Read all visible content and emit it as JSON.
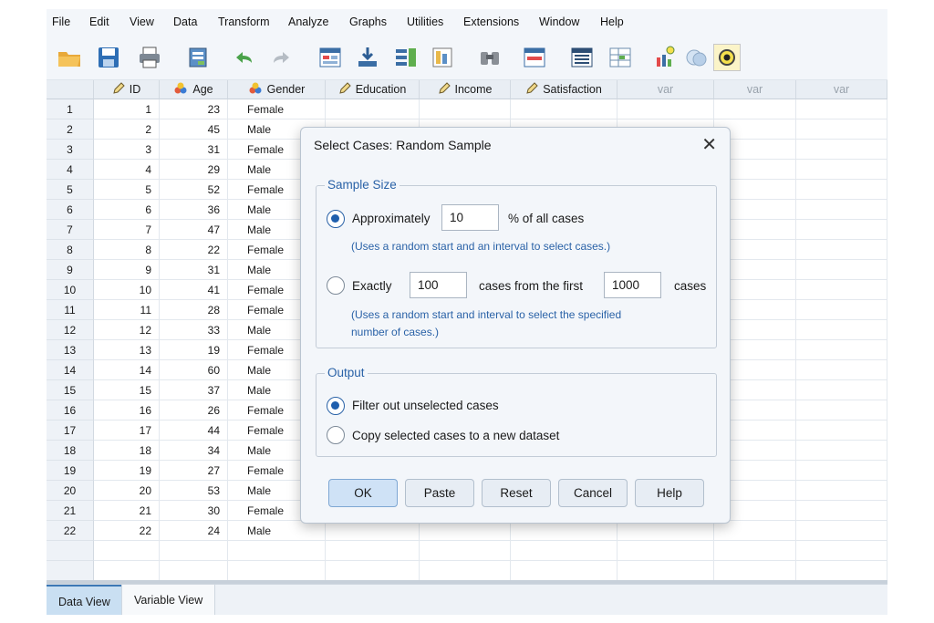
{
  "menu": {
    "file": "File",
    "edit": "Edit",
    "view": "View",
    "data": "Data",
    "transform": "Transform",
    "analyze": "Analyze",
    "graphs": "Graphs",
    "utilities": "Utilities",
    "extensions": "Extensions",
    "window": "Window",
    "help": "Help"
  },
  "toolbar": {
    "icons": [
      "open-folder-icon",
      "save-icon",
      "print-icon",
      "dialog-recall-icon",
      "undo-icon",
      "redo-icon",
      "goto-case-icon",
      "goto-variable-icon",
      "variables-icon",
      "run-descriptives-icon",
      "find-icon",
      "insert-cases-icon",
      "insert-variable-icon",
      "split-file-icon",
      "value-labels-icon",
      "use-sets-icon",
      "show-all-icon"
    ]
  },
  "grid": {
    "columns": [
      {
        "name": "ID",
        "icon": "pencil-icon"
      },
      {
        "name": "Age",
        "icon": "scale-icon"
      },
      {
        "name": "Gender",
        "icon": "nominal-icon"
      },
      {
        "name": "Education",
        "icon": "pencil-icon"
      },
      {
        "name": "Income",
        "icon": "pencil-icon"
      },
      {
        "name": "Satisfaction",
        "icon": "pencil-icon"
      },
      {
        "name": "var"
      },
      {
        "name": "var"
      },
      {
        "name": "var"
      }
    ],
    "rows": [
      {
        "n": "1",
        "id": "1",
        "age": "23",
        "gender": "Female"
      },
      {
        "n": "2",
        "id": "2",
        "age": "45",
        "gender": "Male"
      },
      {
        "n": "3",
        "id": "3",
        "age": "31",
        "gender": "Female"
      },
      {
        "n": "4",
        "id": "4",
        "age": "29",
        "gender": "Male"
      },
      {
        "n": "5",
        "id": "5",
        "age": "52",
        "gender": "Female"
      },
      {
        "n": "6",
        "id": "6",
        "age": "36",
        "gender": "Male"
      },
      {
        "n": "7",
        "id": "7",
        "age": "47",
        "gender": "Male"
      },
      {
        "n": "8",
        "id": "8",
        "age": "22",
        "gender": "Female"
      },
      {
        "n": "9",
        "id": "9",
        "age": "31",
        "gender": "Male"
      },
      {
        "n": "10",
        "id": "10",
        "age": "41",
        "gender": "Female"
      },
      {
        "n": "11",
        "id": "11",
        "age": "28",
        "gender": "Female"
      },
      {
        "n": "12",
        "id": "12",
        "age": "33",
        "gender": "Male"
      },
      {
        "n": "13",
        "id": "13",
        "age": "19",
        "gender": "Female"
      },
      {
        "n": "14",
        "id": "14",
        "age": "60",
        "gender": "Male"
      },
      {
        "n": "15",
        "id": "15",
        "age": "37",
        "gender": "Male"
      },
      {
        "n": "16",
        "id": "16",
        "age": "26",
        "gender": "Female"
      },
      {
        "n": "17",
        "id": "17",
        "age": "44",
        "gender": "Female"
      },
      {
        "n": "18",
        "id": "18",
        "age": "34",
        "gender": "Male"
      },
      {
        "n": "19",
        "id": "19",
        "age": "27",
        "gender": "Female"
      },
      {
        "n": "20",
        "id": "20",
        "age": "53",
        "gender": "Male"
      },
      {
        "n": "21",
        "id": "21",
        "age": "30",
        "gender": "Female"
      },
      {
        "n": "22",
        "id": "22",
        "age": "24",
        "gender": "Male"
      }
    ]
  },
  "tabs": {
    "data_view": "Data View",
    "variable_view": "Variable View",
    "active": "data_view"
  },
  "dialog": {
    "title": "Select Cases: Random Sample",
    "close": "✕",
    "sample_size": {
      "legend": "Sample Size",
      "approx_label": "Approximately",
      "approx_value": "10",
      "approx_suffix": "% of all cases",
      "approx_hint": "(Uses a random start and an interval to select cases.)",
      "exactly_label": "Exactly",
      "exactly_value": "100",
      "exactly_middle": "cases from the first",
      "exactly_total": "1000",
      "exactly_suffix": "cases",
      "exactly_hint_line1": "(Uses a random start and interval to select the specified",
      "exactly_hint_line2": "number of cases.)",
      "selected": "approximately"
    },
    "output": {
      "legend": "Output",
      "filter_label": "Filter out unselected cases",
      "copy_label": "Copy selected cases to a new dataset",
      "selected": "filter"
    },
    "buttons": {
      "ok": "OK",
      "paste": "Paste",
      "reset": "Reset",
      "cancel": "Cancel",
      "help": "Help"
    }
  },
  "colors": {
    "accent": "#2a62a7",
    "radio_fill": "#1f5fad",
    "primary_button": "#cfe2f6"
  }
}
